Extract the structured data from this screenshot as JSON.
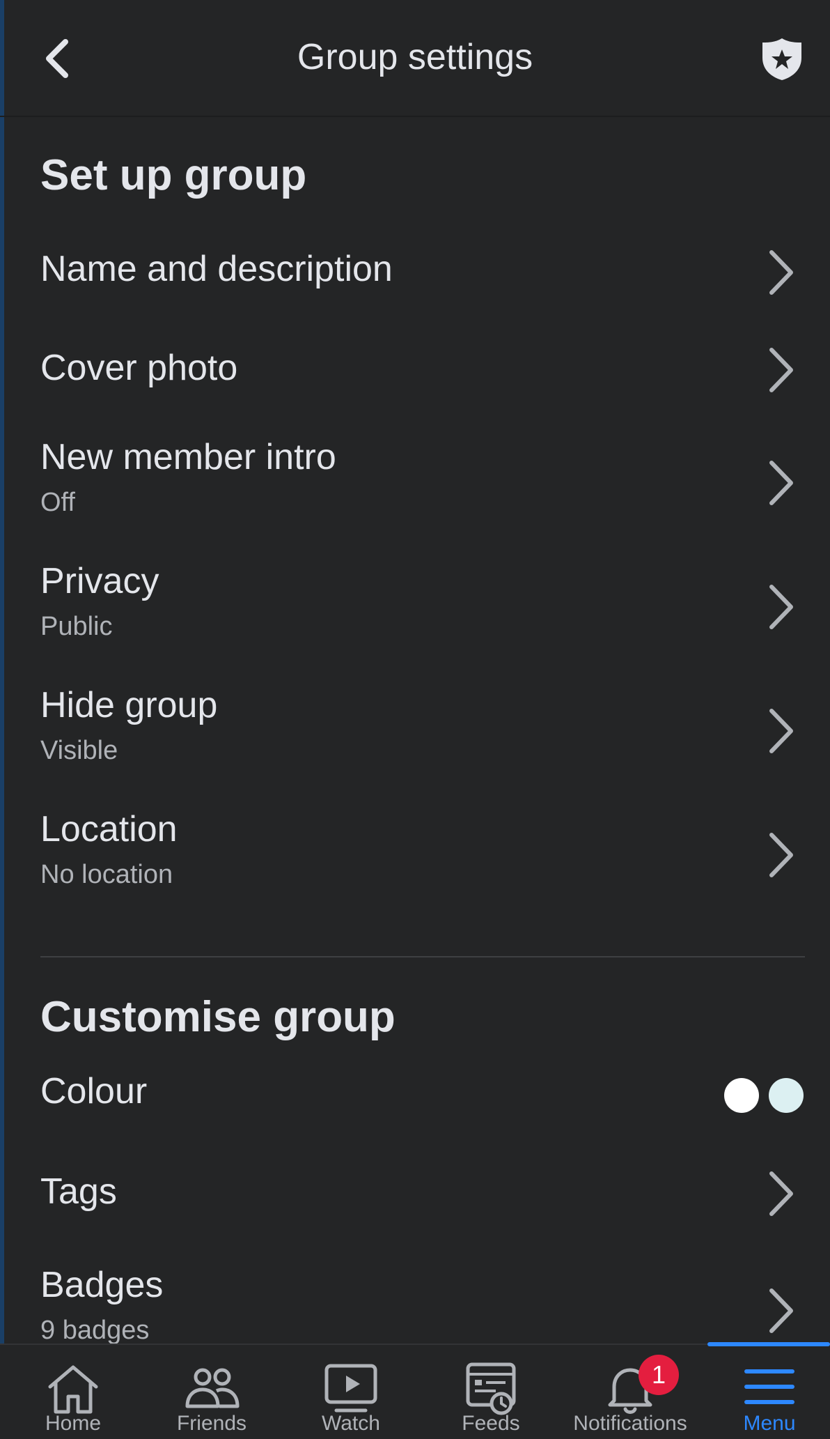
{
  "header": {
    "title": "Group settings",
    "back_icon": "chevron-left-icon",
    "shield_icon": "admin-shield-star-icon"
  },
  "setup_section": {
    "title": "Set up group",
    "items": [
      {
        "label": "Name and description",
        "sub": ""
      },
      {
        "label": "Cover photo",
        "sub": ""
      },
      {
        "label": "New member intro",
        "sub": "Off"
      },
      {
        "label": "Privacy",
        "sub": "Public"
      },
      {
        "label": "Hide group",
        "sub": "Visible"
      },
      {
        "label": "Location",
        "sub": "No location"
      }
    ]
  },
  "customise_section": {
    "title": "Customise group",
    "colour": {
      "label": "Colour",
      "swatches": [
        "#ffffff",
        "#dcf0f2"
      ]
    },
    "items": [
      {
        "label": "Tags",
        "sub": ""
      },
      {
        "label": "Badges",
        "sub": "9 badges"
      }
    ]
  },
  "tabbar": {
    "active_color": "#2d88ff",
    "tabs": [
      {
        "label": "Home",
        "icon": "home-icon"
      },
      {
        "label": "Friends",
        "icon": "friends-icon"
      },
      {
        "label": "Watch",
        "icon": "watch-icon"
      },
      {
        "label": "Feeds",
        "icon": "feeds-icon"
      },
      {
        "label": "Notifications",
        "icon": "bell-icon",
        "badge": "1"
      },
      {
        "label": "Menu",
        "icon": "menu-icon",
        "active": true
      }
    ]
  }
}
